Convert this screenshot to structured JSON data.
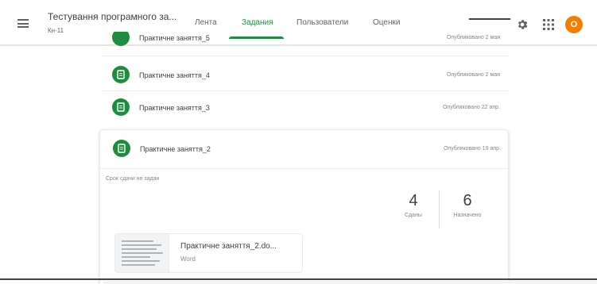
{
  "header": {
    "class_title": "Тестування програмного за...",
    "class_subtitle": "Кн-11",
    "tabs": [
      "Лента",
      "Задания",
      "Пользователи",
      "Оценки"
    ],
    "active_tab": "Задания",
    "avatar_letter": "О",
    "accent_color": "#1e8e3e",
    "avatar_color": "#f57c00"
  },
  "assignments": [
    {
      "title": "Практичне заняття_5",
      "date": "Опубликовано 2 мая"
    },
    {
      "title": "Практичне заняття_4",
      "date": "Опубликовано 2 мая"
    },
    {
      "title": "Практичне заняття_3",
      "date": "Опубликовано 22 апр."
    }
  ],
  "expanded": {
    "title": "Практичне заняття_2",
    "date": "Опубликовано 19 апр.",
    "due": "Срок сдачи не задан",
    "stats": [
      {
        "value": "4",
        "label": "Сданы"
      },
      {
        "value": "6",
        "label": "Назначено"
      }
    ],
    "attachment": {
      "name": "Практичне заняття_2.do...",
      "type": "Word"
    }
  },
  "icons": [
    "menu-icon",
    "assignment-icon",
    "settings-icon",
    "apps-icon",
    "document-thumbnail-icon"
  ]
}
